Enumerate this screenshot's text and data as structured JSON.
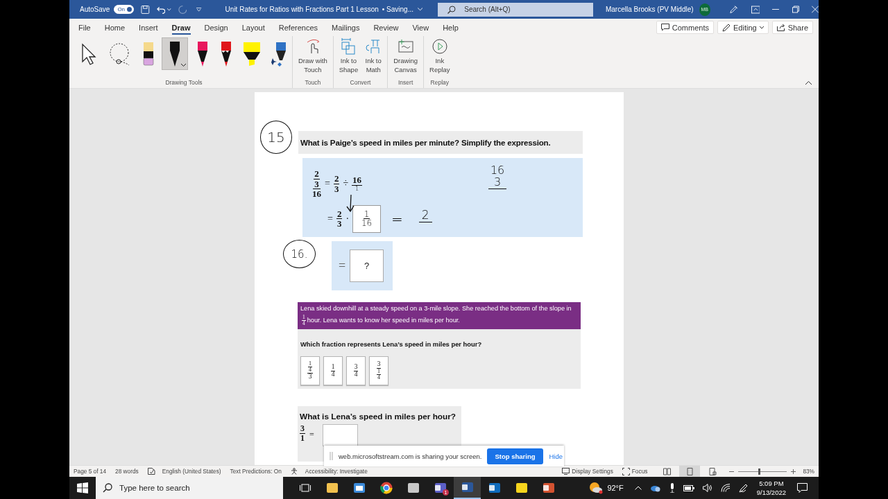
{
  "title_bar": {
    "autosave_label": "AutoSave",
    "autosave": {
      "on": true,
      "label": "On"
    },
    "document_title": "Unit Rates for Ratios with Fractions Part 1 Lesson",
    "save_status": "• Saving...",
    "search_placeholder": "Search (Alt+Q)",
    "user_name": "Marcella Brooks (PV Middle)",
    "avatar_initials": "MB"
  },
  "menu_tabs": [
    {
      "label": "File",
      "selected": false
    },
    {
      "label": "Home",
      "selected": false
    },
    {
      "label": "Insert",
      "selected": false
    },
    {
      "label": "Draw",
      "selected": true
    },
    {
      "label": "Design",
      "selected": false
    },
    {
      "label": "Layout",
      "selected": false
    },
    {
      "label": "References",
      "selected": false
    },
    {
      "label": "Mailings",
      "selected": false
    },
    {
      "label": "Review",
      "selected": false
    },
    {
      "label": "View",
      "selected": false
    },
    {
      "label": "Help",
      "selected": false
    }
  ],
  "ribbon_actions": [
    {
      "kind": "comments",
      "label": "Comments"
    },
    {
      "kind": "editing",
      "label": "Editing"
    },
    {
      "kind": "share",
      "label": "Share"
    }
  ],
  "drawing_tools": {
    "label": "Drawing Tools",
    "tools": [
      {
        "kind": "select",
        "selected": false
      },
      {
        "kind": "lasso",
        "selected": false
      },
      {
        "kind": "eraser",
        "color": "#f5d98b",
        "selected": false
      },
      {
        "kind": "pen",
        "color": "#111111",
        "selected": true
      },
      {
        "kind": "pen",
        "color": "#e8175d",
        "selected": false
      },
      {
        "kind": "pencil",
        "color": "#e0161b",
        "selected": false
      },
      {
        "kind": "highlighter",
        "color": "#fff200",
        "selected": false
      },
      {
        "kind": "action_pen",
        "color": "#2f72c4",
        "selected": false
      }
    ]
  },
  "ribbon_groups": [
    {
      "label": "Touch",
      "buttons": [
        {
          "kind": "touch",
          "lines": [
            "Draw with",
            "Touch"
          ]
        }
      ]
    },
    {
      "label": "Convert",
      "buttons": [
        {
          "kind": "shape",
          "lines": [
            "Ink to",
            "Shape"
          ]
        },
        {
          "kind": "math",
          "lines": [
            "Ink to",
            "Math"
          ]
        }
      ]
    },
    {
      "label": "Insert",
      "buttons": [
        {
          "kind": "canvas",
          "lines": [
            "Drawing",
            "Canvas"
          ]
        }
      ]
    },
    {
      "label": "Replay",
      "buttons": [
        {
          "kind": "replay",
          "lines": [
            "Ink",
            "Replay"
          ]
        }
      ]
    }
  ],
  "document": {
    "question_15": {
      "ink_number": "15",
      "prompt": "What is Paige’s speed in miles per minute? Simplify the expression.",
      "work": {
        "complex_fraction": {
          "num": "2",
          "mid": "3",
          "den": "16"
        },
        "equals": "=",
        "fraction_a": {
          "num": "2",
          "den": "3"
        },
        "divide": "÷",
        "divisor": "16",
        "ink_divisor_den": "1",
        "equals_2": "=",
        "fraction_b": {
          "num": "2",
          "den": "3"
        },
        "times": "·",
        "ink_box": {
          "num": "1",
          "den": "16"
        },
        "ink_equals": "=",
        "ink_result": "2",
        "ink_side": {
          "num": "16",
          "den": "3"
        }
      }
    },
    "question_16": {
      "ink_number": "16.",
      "equals": "=",
      "answer_box": "?"
    },
    "lena_problem": {
      "text_before": "Lena skied downhill at a steady speed on a 3-mile slope. She reached the bottom of the slope in",
      "fraction": {
        "num": "1",
        "den": "4"
      },
      "text_after": "hour. Lena wants to know her speed in miles per hour.",
      "question": "Which fraction represents Lena’s speed in miles per hour?",
      "choices": [
        {
          "kind": "complex_top",
          "top": {
            "num": "1",
            "den": "4"
          },
          "den": "3"
        },
        {
          "kind": "simple",
          "num": "1",
          "den": "4"
        },
        {
          "kind": "simple",
          "num": "3",
          "den": "4"
        },
        {
          "kind": "complex_bottom",
          "num": "3",
          "bottom": {
            "num": "1",
            "den": "4"
          }
        }
      ]
    },
    "speed_question": {
      "prompt": "What is Lena’s speed in miles per hour?",
      "fraction": {
        "num": "3",
        "den": "1"
      },
      "equals": "="
    }
  },
  "share_banner": {
    "message": "web.microsoftstream.com is sharing your screen.",
    "stop_button": "Stop sharing",
    "hide_link": "Hide"
  },
  "status_bar": {
    "page": "Page 5 of 14",
    "words": "28 words",
    "language": "English (United States)",
    "text_predictions": "Text Predictions: On",
    "accessibility": "Accessibility: Investigate",
    "display_settings": "Display Settings",
    "focus": "Focus",
    "views": [
      {
        "kind": "read",
        "selected": false
      },
      {
        "kind": "print",
        "selected": true
      },
      {
        "kind": "web",
        "selected": false
      }
    ],
    "zoom": {
      "level": 0.43,
      "label": "83%"
    }
  },
  "taskbar": {
    "search_placeholder": "Type here to search",
    "apps": [
      {
        "kind": "task_view",
        "active": false
      },
      {
        "kind": "explorer",
        "active": false
      },
      {
        "kind": "store",
        "active": false
      },
      {
        "kind": "chrome",
        "active": false
      },
      {
        "kind": "snipping",
        "active": false
      },
      {
        "kind": "teams",
        "badge": "1",
        "active": false
      },
      {
        "kind": "word",
        "active": true
      },
      {
        "kind": "outlook",
        "active": false
      },
      {
        "kind": "sticky",
        "active": false
      },
      {
        "kind": "powerpoint",
        "active": false
      }
    ],
    "weather": "92°F",
    "time": "5:09 PM",
    "date": "9/13/2022"
  }
}
